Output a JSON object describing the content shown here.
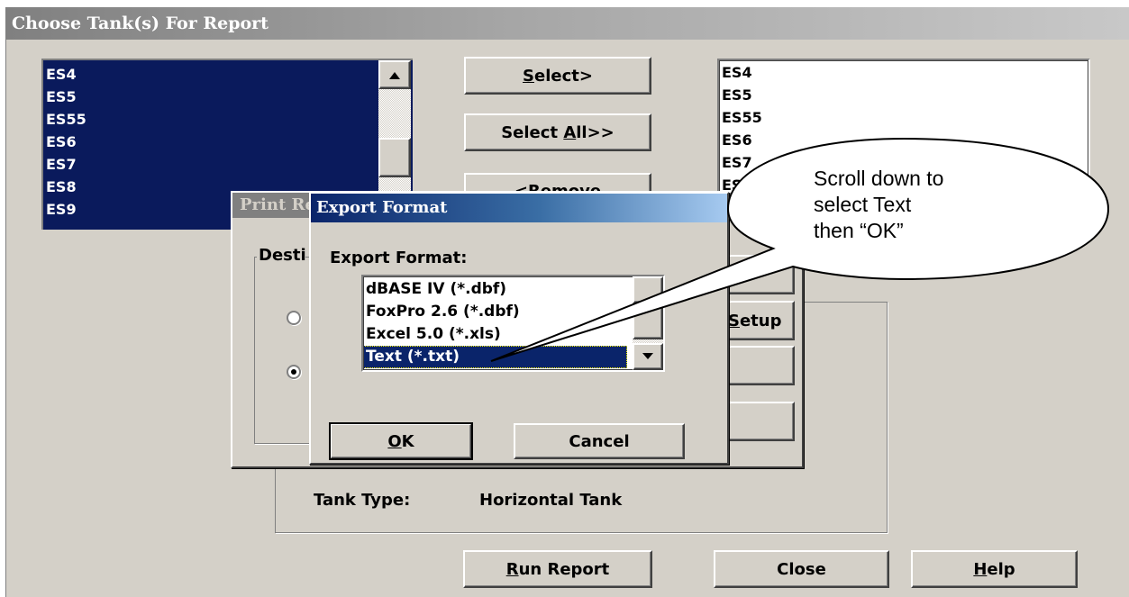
{
  "main_window": {
    "title": "Choose Tank(s) For Report",
    "available_tanks": [
      "ES4",
      "ES5",
      "ES55",
      "ES6",
      "ES7",
      "ES8",
      "ES9"
    ],
    "selected_tanks": [
      "ES4",
      "ES5",
      "ES55",
      "ES6",
      "ES7",
      "ES8"
    ],
    "buttons": {
      "select": {
        "pre": "",
        "key": "S",
        "post": "elect>"
      },
      "select_all": {
        "pre": "Select ",
        "key": "A",
        "post": "ll>>"
      },
      "remove": "<Remove",
      "run_report": {
        "pre": "",
        "key": "R",
        "post": "un Report"
      },
      "close": "Close",
      "help": {
        "pre": "",
        "key": "H",
        "post": "elp"
      }
    },
    "tank_type_label": "Tank Type:",
    "tank_type_value": "Horizontal Tank"
  },
  "print_dialog": {
    "title": "Print Report",
    "group_label": "Destination",
    "setup_button": {
      "pre": "",
      "key": "S",
      "post": "etup"
    }
  },
  "export_dialog": {
    "title": "Export Format",
    "label": "Export Format:",
    "options": [
      "dBASE IV (*.dbf)",
      "FoxPro 2.6 (*.dbf)",
      "Excel 5.0 (*.xls)",
      "Text (*.txt)"
    ],
    "selected_index": 3,
    "selected_value": "Text (*.txt)",
    "ok": {
      "pre": "",
      "key": "O",
      "post": "K"
    },
    "cancel": "Cancel"
  },
  "callout": {
    "lines": [
      "Scroll down to",
      "select Text",
      "then “OK”"
    ]
  },
  "colors": {
    "selection": "#0a246a",
    "face": "#d4d0c8",
    "active_title_start": "#0a246a",
    "active_title_end": "#a6caf0"
  },
  "icons": [
    "scroll-up-arrow-icon",
    "scroll-down-arrow-icon",
    "dropdown-arrow-icon"
  ]
}
